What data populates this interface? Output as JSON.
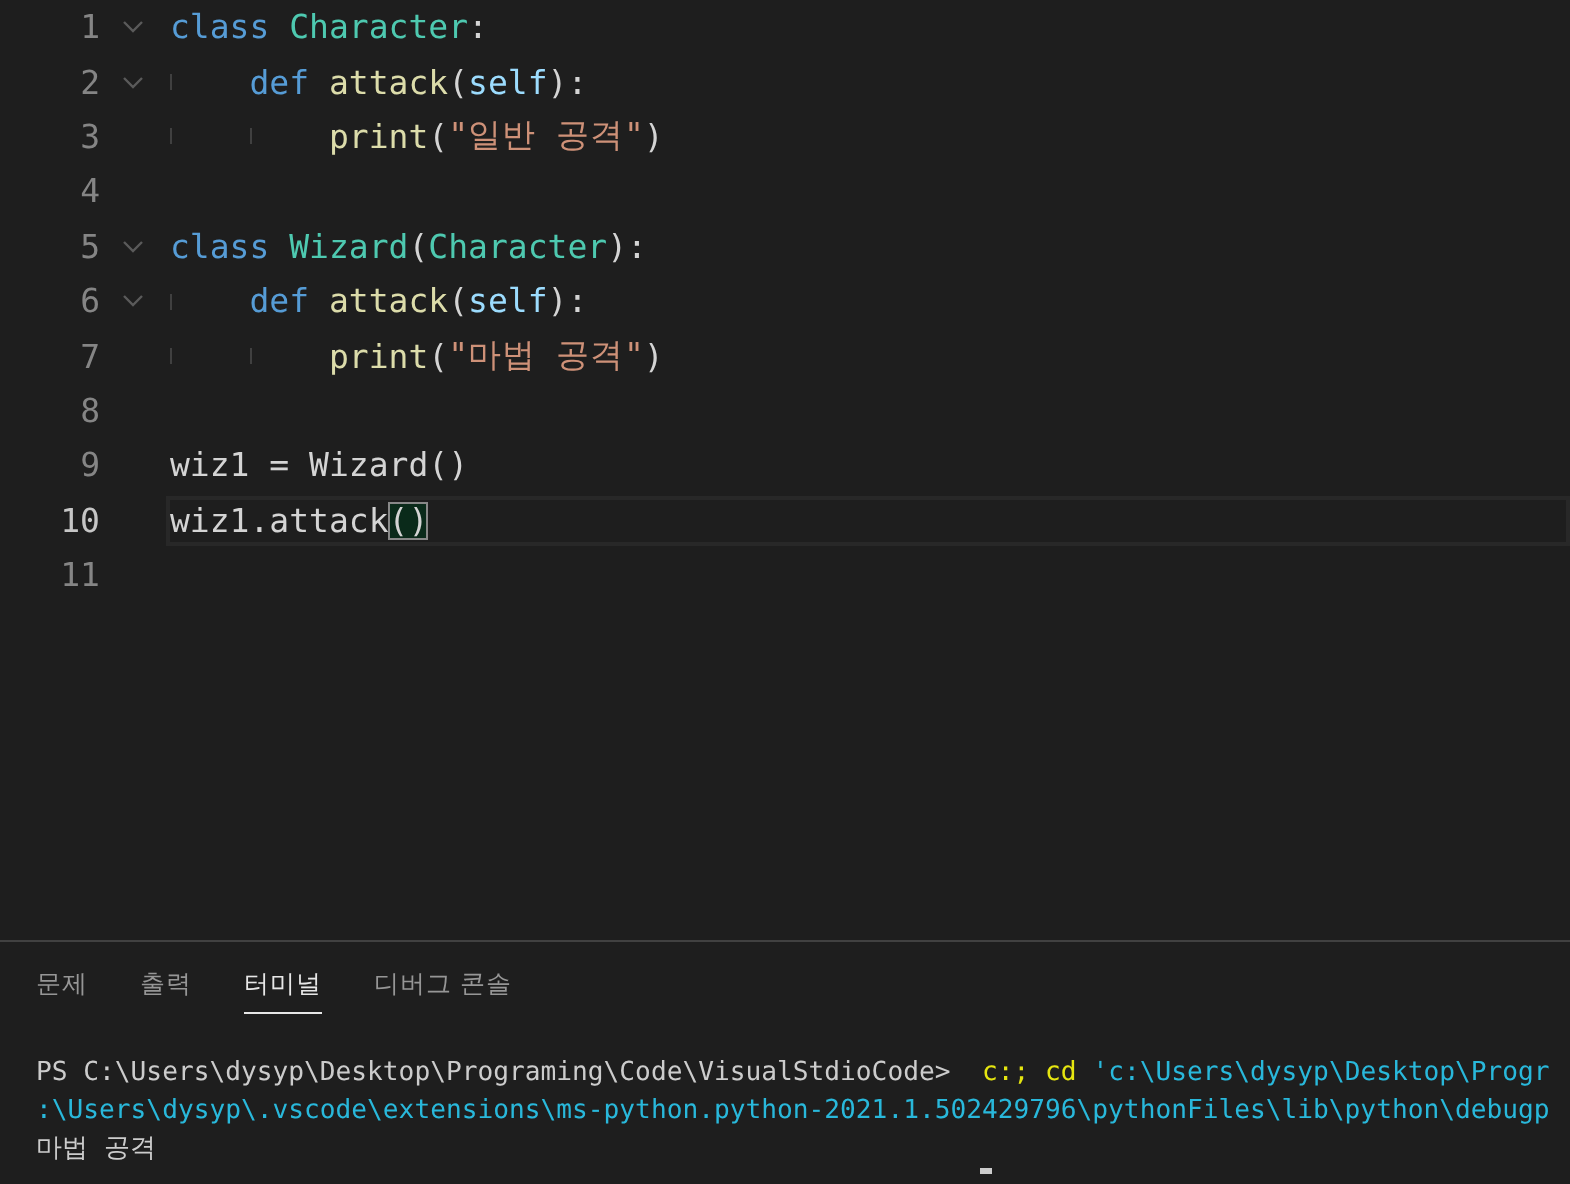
{
  "editor": {
    "lines": [
      {
        "number": "1",
        "foldable": true,
        "current": false,
        "tokens": [
          {
            "text": "class",
            "kind": "keyword"
          },
          {
            "text": " Character",
            "kind": "class"
          },
          {
            "text": ":",
            "kind": "plain"
          }
        ],
        "children": [
          {
            "number": "2",
            "foldable": true,
            "current": false,
            "tokens": [
              {
                "text": "def",
                "kind": "keyword"
              },
              {
                "text": " attack",
                "kind": "function"
              },
              {
                "text": "(",
                "kind": "plain"
              },
              {
                "text": "self",
                "kind": "param"
              },
              {
                "text": "):",
                "kind": "plain"
              }
            ],
            "children": [
              {
                "number": "3",
                "foldable": false,
                "current": false,
                "tokens": [
                  {
                    "text": "print",
                    "kind": "function"
                  },
                  {
                    "text": "(",
                    "kind": "plain"
                  },
                  {
                    "text": "\"일반 공격\"",
                    "kind": "string"
                  },
                  {
                    "text": ")",
                    "kind": "plain"
                  }
                ]
              }
            ]
          }
        ]
      },
      {
        "number": "4",
        "foldable": false,
        "current": false
      },
      {
        "number": "5",
        "foldable": true,
        "current": false,
        "tokens": [
          {
            "text": "class",
            "kind": "keyword"
          },
          {
            "text": " Wizard",
            "kind": "class"
          },
          {
            "text": "(",
            "kind": "plain"
          },
          {
            "text": "Character",
            "kind": "class"
          },
          {
            "text": "):",
            "kind": "plain"
          }
        ],
        "children": [
          {
            "number": "6",
            "foldable": true,
            "current": false,
            "tokens": [
              {
                "text": "def",
                "kind": "keyword"
              },
              {
                "text": " attack",
                "kind": "function"
              },
              {
                "text": "(",
                "kind": "plain"
              },
              {
                "text": "self",
                "kind": "param"
              },
              {
                "text": "):",
                "kind": "plain"
              }
            ],
            "children": [
              {
                "number": "7",
                "foldable": false,
                "current": false,
                "tokens": [
                  {
                    "text": "print",
                    "kind": "function"
                  },
                  {
                    "text": "(",
                    "kind": "plain"
                  },
                  {
                    "text": "\"마법 공격\"",
                    "kind": "string"
                  },
                  {
                    "text": ")",
                    "kind": "plain"
                  }
                ]
              }
            ]
          }
        ]
      },
      {
        "number": "8",
        "foldable": false,
        "current": false
      },
      {
        "number": "9",
        "foldable": false,
        "current": false,
        "tokens": [
          {
            "text": "wiz1 = Wizard()",
            "kind": "plain"
          }
        ]
      },
      {
        "number": "10",
        "foldable": false,
        "current": true,
        "tokens": [
          {
            "text": "wiz1.attack",
            "kind": "plain"
          },
          {
            "text": "()",
            "kind": "bracket-match"
          }
        ]
      },
      {
        "number": "11",
        "foldable": false,
        "current": false
      }
    ]
  },
  "panel": {
    "tabs": [
      {
        "label": "문제",
        "selected": false
      },
      {
        "label": "출력",
        "selected": false
      },
      {
        "label": "터미널",
        "selected": true
      },
      {
        "label": "디버그 콘솔",
        "selected": false
      }
    ],
    "terminal": {
      "lines": [
        {
          "tokens": [
            {
              "text": "PS C:\\Users\\dysyp\\Desktop\\Programing\\Code\\VisualStdioCode>",
              "kind": "plain"
            },
            {
              "text": "  c:;",
              "kind": "command"
            },
            {
              "text": " cd",
              "kind": "command"
            },
            {
              "text": " 'c:\\Users\\dysyp\\Desktop\\Progr",
              "kind": "path"
            }
          ]
        },
        {
          "tokens": [
            {
              "text": ":\\Users\\dysyp\\.vscode\\extensions\\ms-python.python-2021.1.502429796\\pythonFiles\\lib\\python\\debugp",
              "kind": "path"
            }
          ]
        },
        {
          "tokens": [
            {
              "text": "마법 공격",
              "kind": "plain"
            }
          ]
        }
      ]
    }
  }
}
